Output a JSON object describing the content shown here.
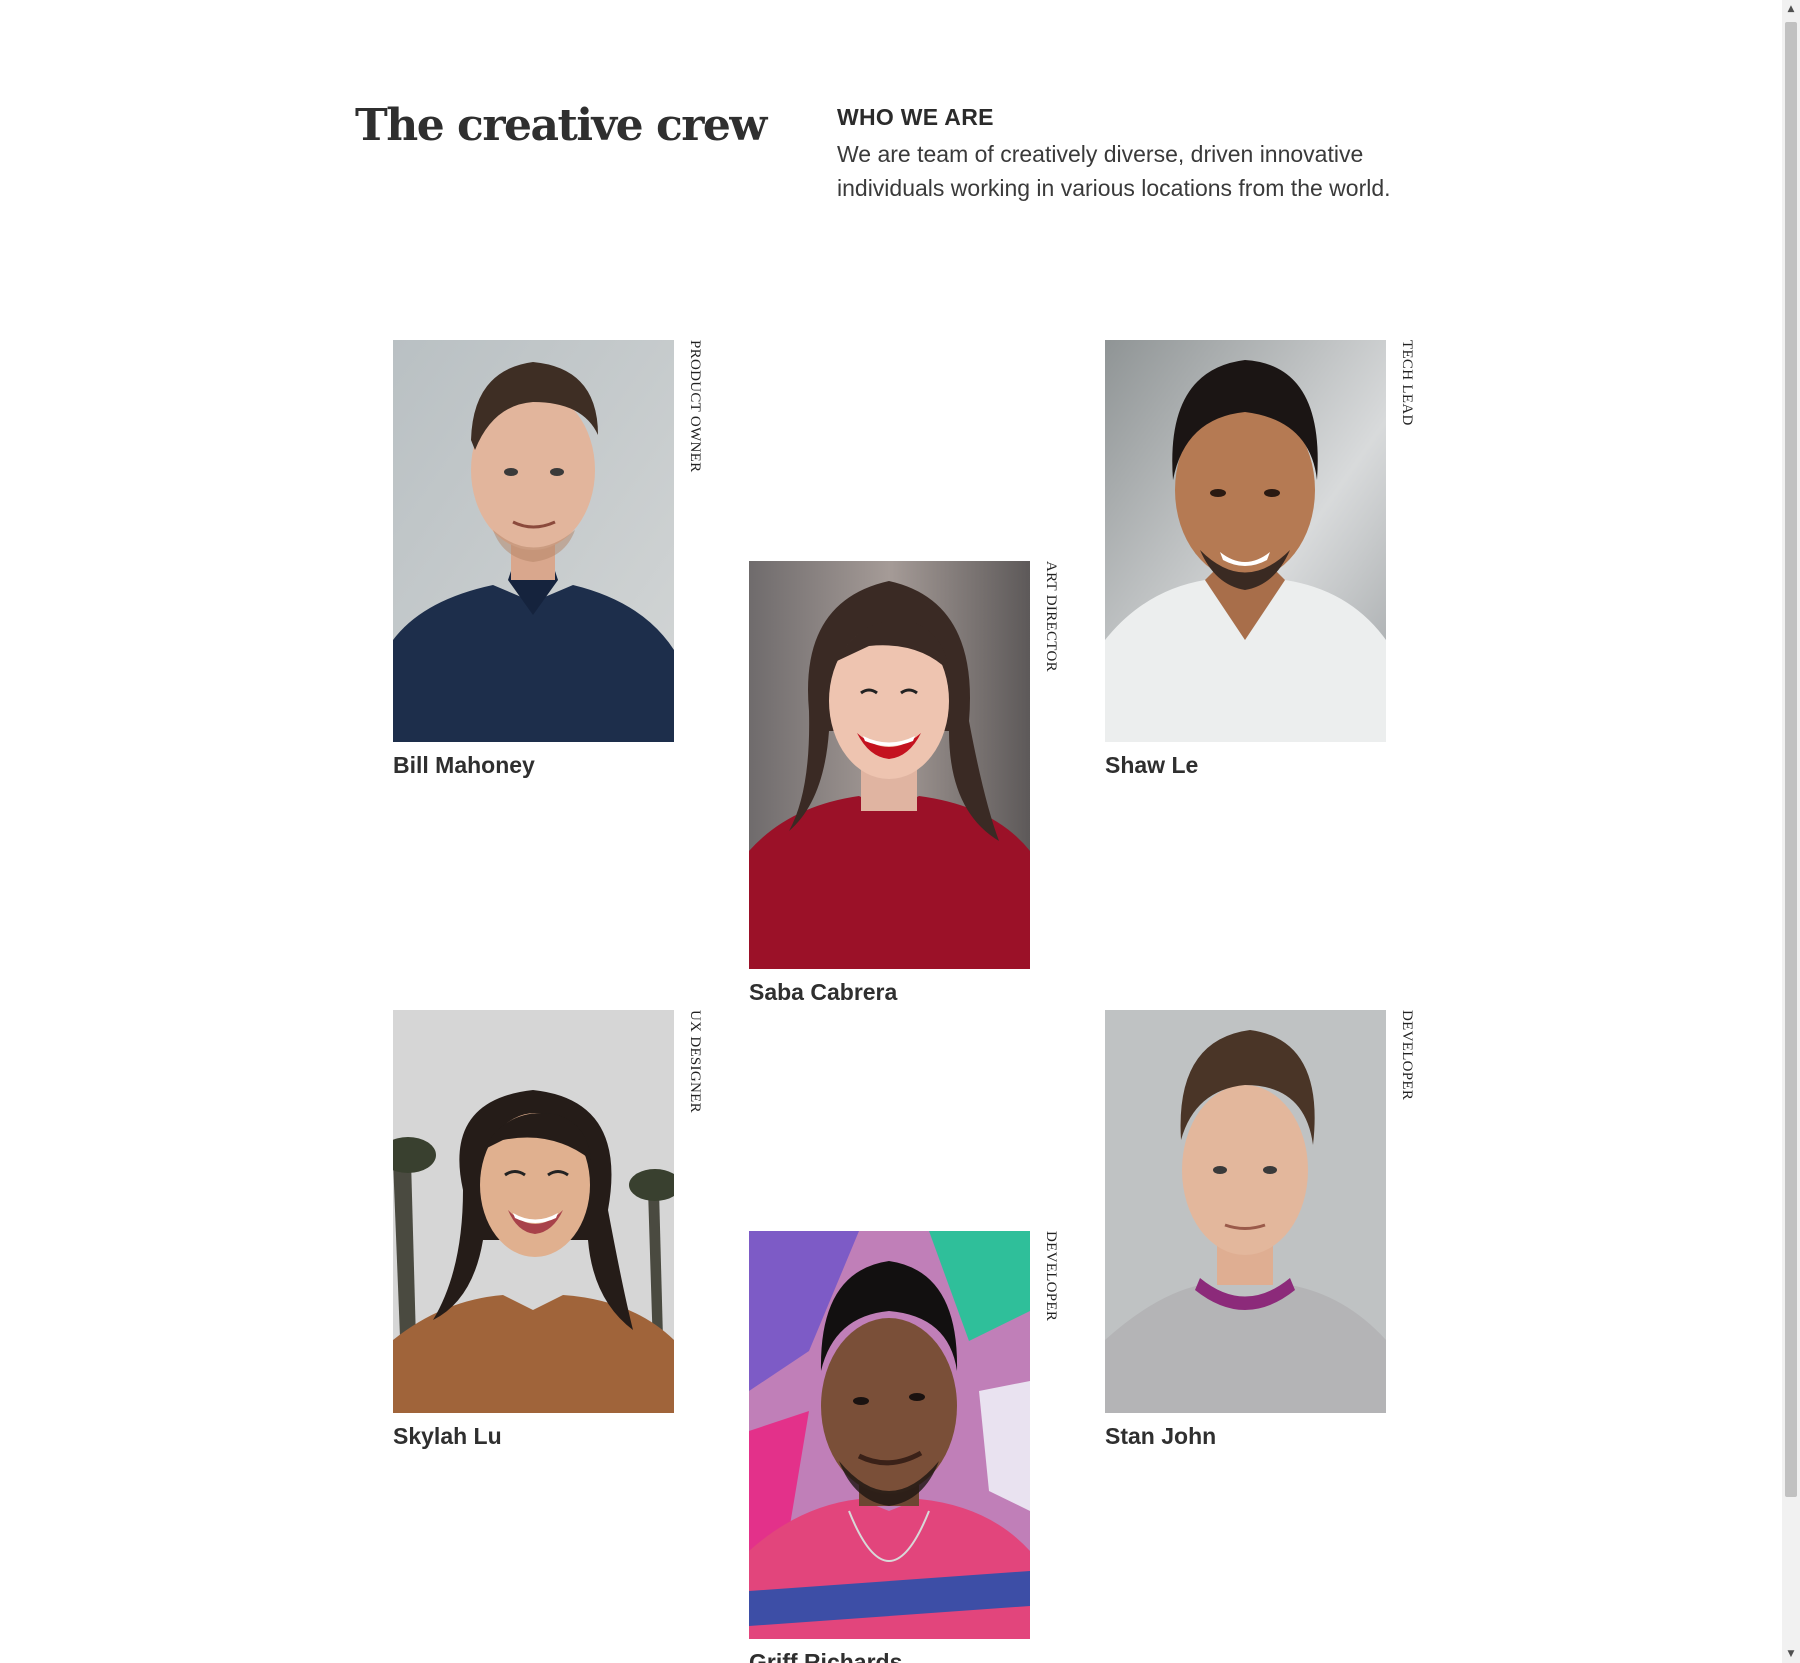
{
  "header": {
    "title": "The creative crew",
    "about_heading": "WHO WE ARE",
    "about_text": "We are team of creatively diverse, driven innovative individuals working in various locations from the world."
  },
  "team": [
    {
      "name": "Bill Mahoney",
      "role": "PRODUCT OWNER"
    },
    {
      "name": "Saba Cabrera",
      "role": "ART DIRECTOR"
    },
    {
      "name": "Shaw Le",
      "role": "TECH LEAD"
    },
    {
      "name": "Skylah Lu",
      "role": "UX DESIGNER"
    },
    {
      "name": "Griff Richards",
      "role": "DEVELOPER"
    },
    {
      "name": "Stan John",
      "role": "DEVELOPER"
    }
  ],
  "scrollbar": {
    "up_arrow": "▲",
    "down_arrow": "▼"
  },
  "icons": [
    "chevron-up-icon",
    "chevron-down-icon"
  ]
}
